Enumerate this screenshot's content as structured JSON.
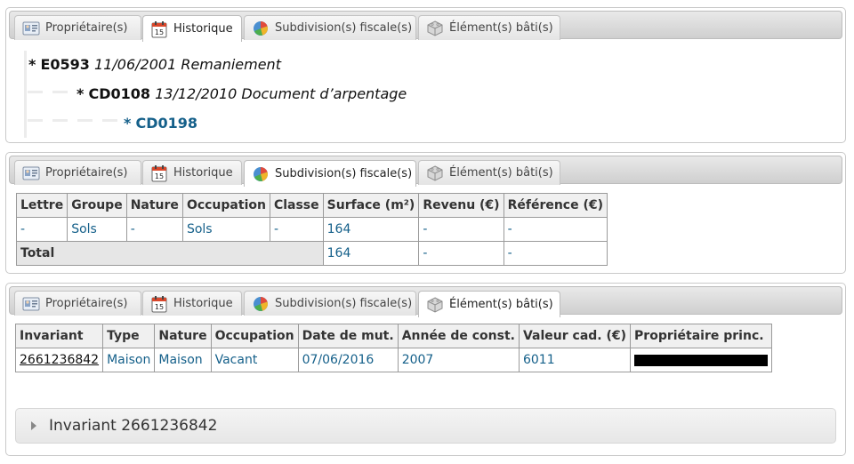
{
  "tabs": [
    {
      "label": "Propriétaire(s)",
      "icon": "owner-card-icon"
    },
    {
      "label": "Historique",
      "icon": "calendar-icon"
    },
    {
      "label": "Subdivision(s) fiscale(s)",
      "icon": "pie-chart-icon"
    },
    {
      "label": "Élément(s) bâti(s)",
      "icon": "building-blocks-icon"
    }
  ],
  "history": [
    {
      "star": "*",
      "code": "E0593",
      "meta": "11/06/2001 Remaniement"
    },
    {
      "star": "*",
      "code": "CD0108",
      "meta": "13/12/2010 Document d’arpentage"
    },
    {
      "star": "*",
      "code": "CD0198",
      "meta": ""
    }
  ],
  "subdivisions": {
    "headers": [
      "Lettre",
      "Groupe",
      "Nature",
      "Occupation",
      "Classe",
      "Surface (m²)",
      "Revenu (€)",
      "Référence (€)"
    ],
    "rows": [
      [
        "-",
        "Sols",
        "-",
        "Sols",
        "-",
        "164",
        "-",
        "-"
      ]
    ],
    "total": {
      "label": "Total",
      "surface": "164",
      "revenu": "-",
      "reference": "-"
    }
  },
  "batis": {
    "headers": [
      "Invariant",
      "Type",
      "Nature",
      "Occupation",
      "Date de mut.",
      "Année de const.",
      "Valeur cad. (€)",
      "Propriétaire princ."
    ],
    "rows": [
      [
        "2661236842",
        "Maison",
        "Maison",
        "Vacant",
        "07/06/2016",
        "2007",
        "6011",
        ""
      ]
    ]
  },
  "accordion": {
    "label": "Invariant 2661236842"
  },
  "colors": {
    "link": "#15608a",
    "header_bg": "#f0f0f0",
    "total_bg": "#e6e6e6"
  }
}
